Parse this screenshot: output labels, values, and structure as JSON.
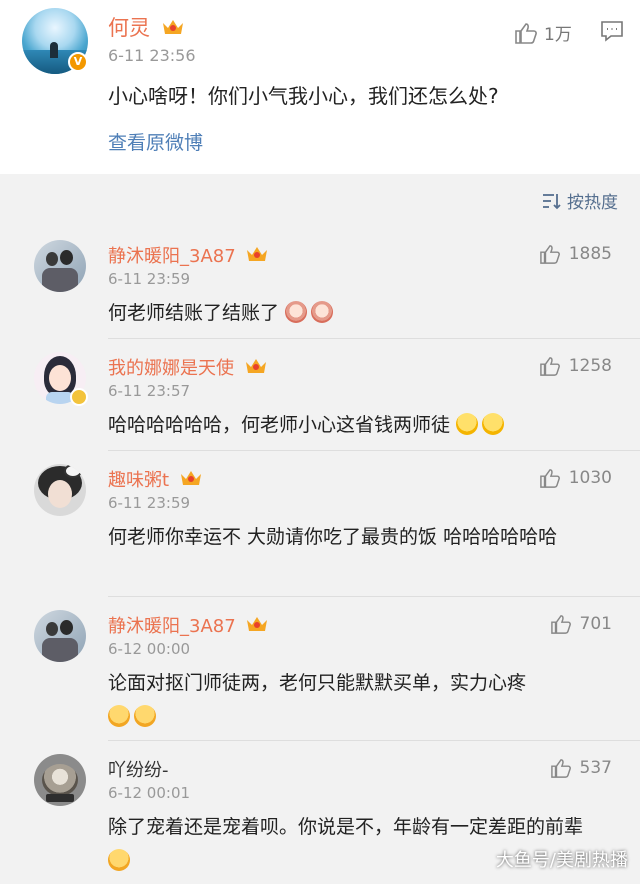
{
  "post": {
    "author": "何灵",
    "verified_badge": "V",
    "time": "6-11 23:56",
    "likes": "1万",
    "text": "小心啥呀！你们小气我小心，我们还怎么处?",
    "view_original": "查看原微博"
  },
  "sort": {
    "label": "按热度",
    "icon": "sort-icon"
  },
  "comments": [
    {
      "name": "静沐暖阳_3A87",
      "time": "6-11 23:59",
      "likes": "1885",
      "text": "何老师结账了结账了",
      "emojis": [
        "monkey",
        "monkey"
      ],
      "vip": true
    },
    {
      "name": "我的娜娜是天使",
      "time": "6-11 23:57",
      "likes": "1258",
      "text": "哈哈哈哈哈哈，何老师小心这省钱两师徒",
      "emojis": [
        "laugh",
        "laugh"
      ],
      "vip": true
    },
    {
      "name": "趣味粥t",
      "time": "6-11 23:59",
      "likes": "1030",
      "text": "何老师你幸运不 大勋请你吃了最贵的饭 哈哈哈哈哈哈",
      "emojis": [],
      "vip": true
    },
    {
      "name": "静沐暖阳_3A87",
      "time": "6-12 00:00",
      "likes": "701",
      "text": "论面对抠门师徒两，老何只能默默买单，实力心疼",
      "emojis": [
        "yum",
        "yum"
      ],
      "vip": true
    },
    {
      "name": "吖纷纷-",
      "time": "6-12 00:01",
      "likes": "537",
      "text": "除了宠着还是宠着呗。你说是不，年龄有一定差距的前辈",
      "emojis": [
        "yum"
      ],
      "vip": false
    }
  ],
  "watermark": "大鱼号/美剧热播",
  "colors": {
    "name_vip": "#eb7350",
    "link": "#4f7fb7",
    "muted": "#999999",
    "bg": "#f2f2f2"
  }
}
